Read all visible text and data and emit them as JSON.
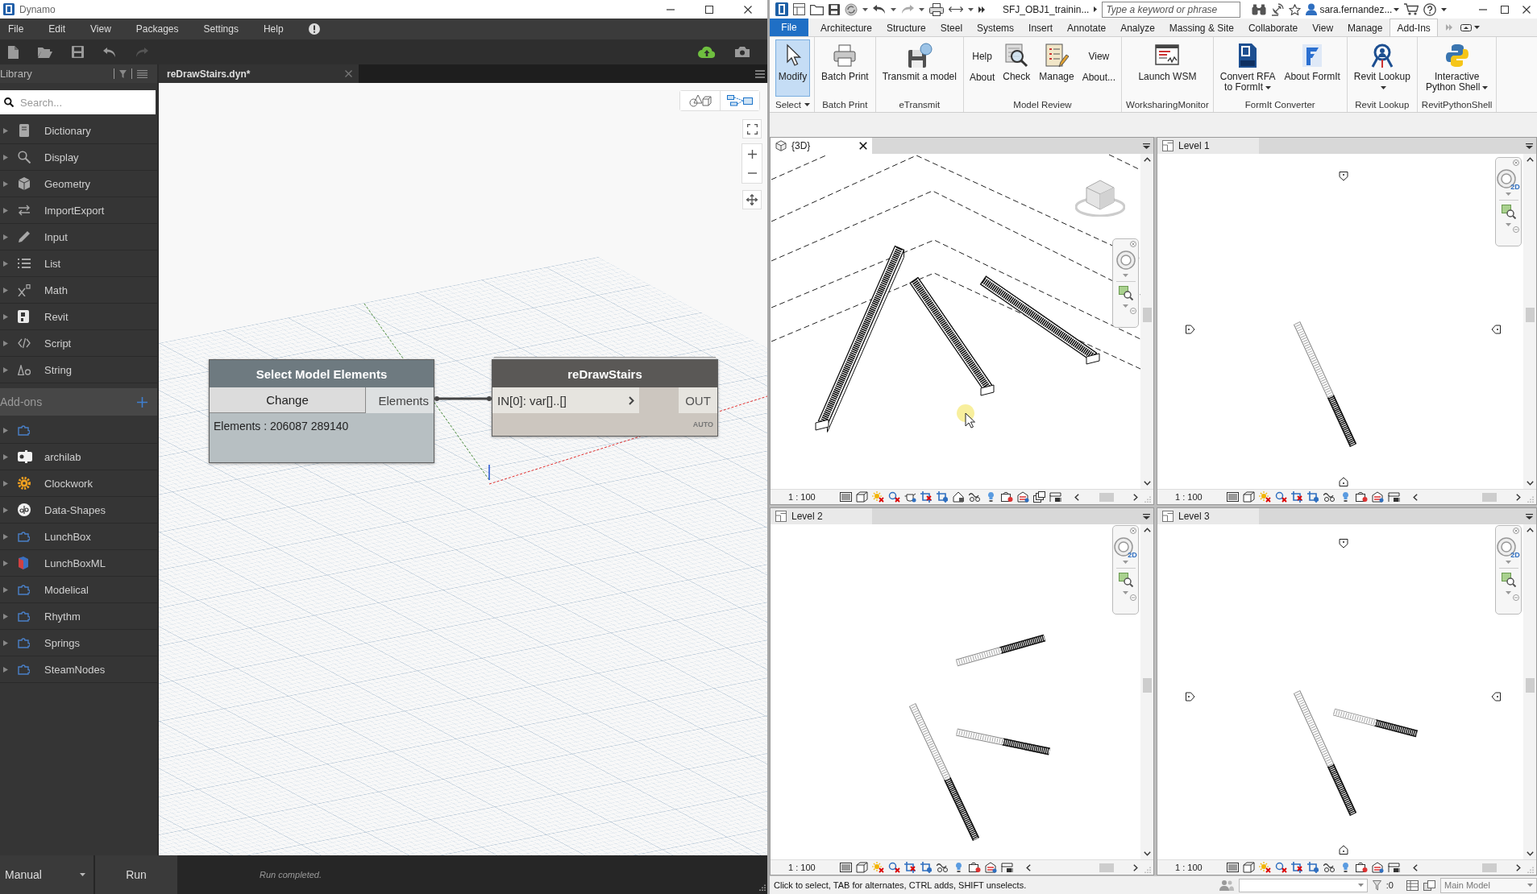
{
  "dynamo": {
    "window": {
      "title": "Dynamo"
    },
    "menu": [
      "File",
      "Edit",
      "View",
      "Packages",
      "Settings",
      "Help"
    ],
    "library": {
      "title": "Library",
      "search": {
        "placeholder": "Search..."
      },
      "categories": [
        {
          "label": "Dictionary",
          "expanded": false
        },
        {
          "label": "Display",
          "expanded": false
        },
        {
          "label": "Geometry",
          "expanded": false
        },
        {
          "label": "ImportExport",
          "expanded": false
        },
        {
          "label": "Input",
          "expanded": false
        },
        {
          "label": "List",
          "expanded": false
        },
        {
          "label": "Math",
          "expanded": false
        },
        {
          "label": "Revit",
          "expanded": false
        },
        {
          "label": "Script",
          "expanded": false
        },
        {
          "label": "String",
          "expanded": false
        }
      ],
      "addons_title": "Add-ons",
      "addons": [
        {
          "expanded": false
        },
        {
          "label": "archilab",
          "expanded": false
        },
        {
          "label": "Clockwork",
          "expanded": false
        },
        {
          "label": "Data-Shapes",
          "expanded": false
        },
        {
          "label": "LunchBox",
          "expanded": false
        },
        {
          "label": "LunchBoxML",
          "expanded": false
        },
        {
          "label": "Modelical",
          "expanded": false
        },
        {
          "label": "Rhythm",
          "expanded": false
        },
        {
          "label": "Springs",
          "expanded": false
        },
        {
          "label": "SteamNodes",
          "expanded": false
        }
      ]
    },
    "tabs": [
      {
        "label": "reDrawStairs.dyn*",
        "selected": true
      }
    ],
    "views": [
      {
        "kind": "geometry",
        "selected": false
      },
      {
        "kind": "graph",
        "selected": true
      }
    ],
    "nodes": [
      {
        "kind": "selection",
        "title": "Select Model Elements",
        "button": "Change",
        "output": "Elements",
        "preview": "Elements : 206087 289140"
      },
      {
        "kind": "code",
        "title": "reDrawStairs",
        "input": "IN[0]: var[]..[]",
        "output": "OUT",
        "lacing": "AUTO"
      }
    ],
    "run": {
      "mode": "Manual",
      "button": "Run",
      "status": "Run completed."
    }
  },
  "revit": {
    "title": {
      "file": "SFJ_OBJ1_trainin..."
    },
    "search": {
      "placeholder": "Type a keyword or phrase"
    },
    "user": "sara.fernandez...",
    "ribbon": {
      "file_tab": "File",
      "tabs": [
        {
          "label": "Architecture",
          "selected": false
        },
        {
          "label": "Structure",
          "selected": false
        },
        {
          "label": "Steel",
          "selected": false
        },
        {
          "label": "Systems",
          "selected": false
        },
        {
          "label": "Insert",
          "selected": false
        },
        {
          "label": "Annotate",
          "selected": false
        },
        {
          "label": "Analyze",
          "selected": false
        },
        {
          "label": "Massing & Site",
          "selected": false
        },
        {
          "label": "Collaborate",
          "selected": false
        },
        {
          "label": "View",
          "selected": false
        },
        {
          "label": "Manage",
          "selected": false
        },
        {
          "label": "Add-Ins",
          "selected": true
        }
      ],
      "panels": [
        {
          "label": "Select",
          "dropdown": true,
          "items": [
            {
              "kind": "large",
              "label": [
                "Modify"
              ],
              "selected": true,
              "dropdown": false
            }
          ]
        },
        {
          "label": "Batch Print",
          "dropdown": false,
          "items": [
            {
              "kind": "large",
              "label": [
                "Batch Print"
              ],
              "selected": false,
              "dropdown": false
            }
          ]
        },
        {
          "label": "eTransmit",
          "dropdown": false,
          "items": [
            {
              "kind": "large",
              "label": [
                "Transmit a model"
              ],
              "selected": false,
              "dropdown": false
            }
          ]
        },
        {
          "label": "Model Review",
          "dropdown": false,
          "items": [
            {
              "kind": "stack",
              "buttons": [
                "Help",
                "About"
              ]
            },
            {
              "kind": "large",
              "label": [
                "Check"
              ],
              "selected": false,
              "dropdown": false
            },
            {
              "kind": "large",
              "label": [
                "Manage"
              ],
              "selected": false,
              "dropdown": false
            },
            {
              "kind": "stack",
              "buttons": [
                "View",
                "About..."
              ]
            }
          ]
        },
        {
          "label": "WorksharingMonitor",
          "dropdown": false,
          "items": [
            {
              "kind": "large",
              "label": [
                "Launch WSM"
              ],
              "selected": false,
              "dropdown": false
            }
          ]
        },
        {
          "label": "FormIt Converter",
          "dropdown": false,
          "items": [
            {
              "kind": "large",
              "label": [
                "Convert RFA",
                "to FormIt"
              ],
              "selected": false,
              "dropdown": true
            },
            {
              "kind": "large",
              "label": [
                "About FormIt"
              ],
              "selected": false,
              "dropdown": false
            }
          ]
        },
        {
          "label": "Revit Lookup",
          "dropdown": false,
          "items": [
            {
              "kind": "large",
              "label": [
                "Revit Lookup"
              ],
              "selected": false,
              "dropdown": true
            }
          ]
        },
        {
          "label": "RevitPythonShell",
          "dropdown": false,
          "items": [
            {
              "kind": "large",
              "label": [
                "Interactive",
                "Python Shell"
              ],
              "selected": false,
              "dropdown": true
            }
          ]
        }
      ]
    },
    "views": [
      {
        "title": "{3D}",
        "kind": "perspective",
        "active": true,
        "scale": "1 : 100"
      },
      {
        "title": "Level 1",
        "kind": "plan",
        "active": false,
        "scale": "1 : 100",
        "navigation_badge": "2D"
      },
      {
        "title": "Level 2",
        "kind": "plan",
        "active": false,
        "scale": "1 : 100",
        "navigation_badge": "2D"
      },
      {
        "title": "Level 3",
        "kind": "plan",
        "active": false,
        "scale": "1 : 100",
        "navigation_badge": "2D"
      }
    ],
    "status_bar": {
      "message": "Click to select, TAB for alternates, CTRL adds, SHIFT unselects.",
      "selection_count": ":0",
      "model": "Main Model"
    }
  }
}
